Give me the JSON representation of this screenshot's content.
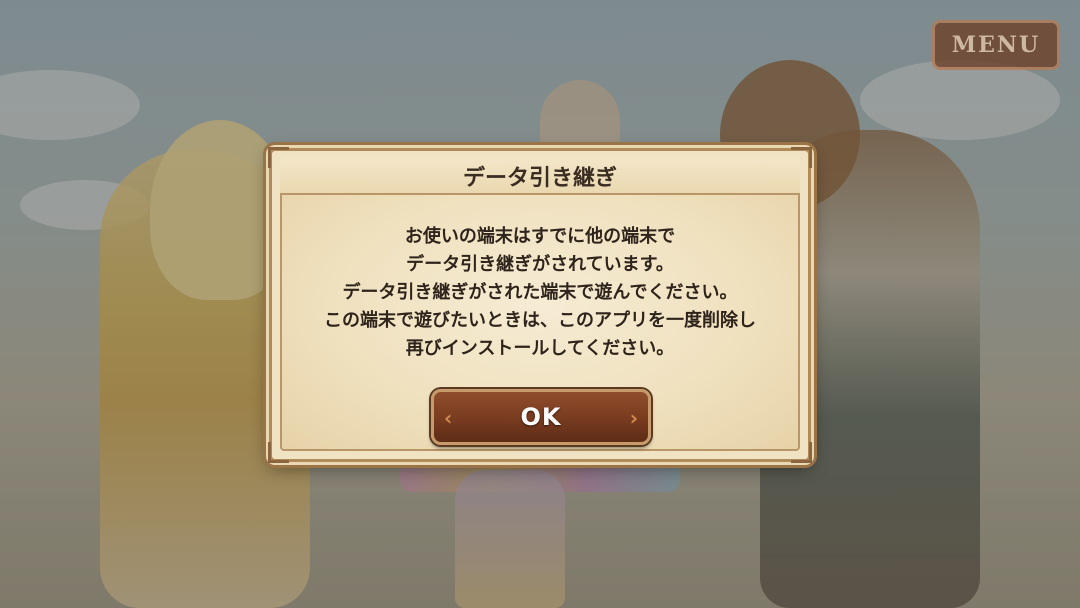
{
  "menu_button": {
    "label": "MENU"
  },
  "dialog": {
    "title": "データ引き継ぎ",
    "message_lines": [
      "お使いの端末はすでに他の端末で",
      "データ引き継ぎがされています。",
      "データ引き継ぎがされた端末で遊んでください。",
      "この端末で遊びたいときは、このアプリを一度削除し",
      "再びインストールしてください。"
    ],
    "ok_button": {
      "label": "OK"
    }
  },
  "colors": {
    "dialog_background": "#efe3c4",
    "dialog_border": "#b08a59",
    "ok_button": "#7a3d20",
    "menu_button": "#6b3b22"
  },
  "icons": {
    "ok_left": "chevron-left-icon",
    "ok_right": "chevron-right-icon"
  }
}
